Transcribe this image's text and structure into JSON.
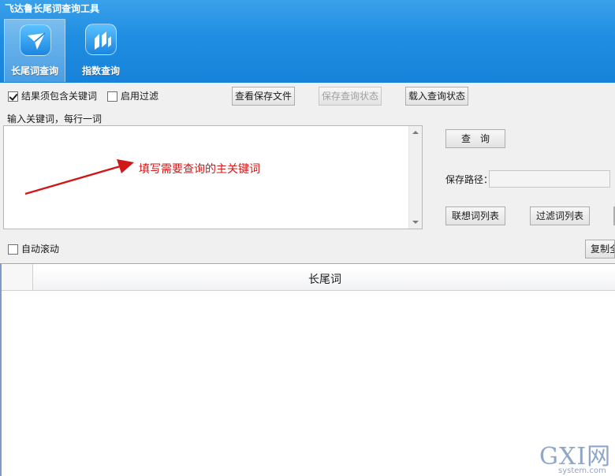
{
  "window": {
    "title": "飞达鲁长尾词查询工具"
  },
  "nav": {
    "tabs": [
      {
        "label": "长尾词查询",
        "icon": "paper-plane-icon",
        "active": true
      },
      {
        "label": "指数查询",
        "icon": "index-chart-icon",
        "active": false
      }
    ]
  },
  "options": {
    "must_include_keyword": {
      "label": "结果须包含关键词",
      "checked": true
    },
    "enable_filter": {
      "label": "启用过滤",
      "checked": false
    },
    "auto_scroll": {
      "label": "自动滚动",
      "checked": false
    }
  },
  "toolbar": {
    "view_saved_file": "查看保存文件",
    "save_query_state": "保存查询状态",
    "load_query_state": "载入查询状态"
  },
  "keywords": {
    "label": "输入关键词，每行一词",
    "value": "",
    "annotation": "填写需要查询的主关键词"
  },
  "right_panel": {
    "query_button": "查　询",
    "save_path_label": "保存路径：",
    "save_path_value": "",
    "related_words_button": "联想词列表",
    "filter_words_button": "过滤词列表",
    "copy_all_button": "复制全"
  },
  "results": {
    "columns": [
      "长尾词"
    ],
    "rows": []
  },
  "watermark": {
    "big": "GXI网",
    "small": "system.com"
  },
  "colors": {
    "header": "#1f8ee2",
    "annotation": "#d01818"
  }
}
